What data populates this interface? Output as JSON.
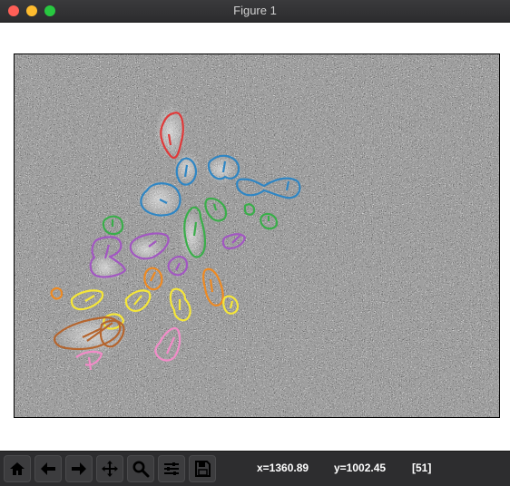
{
  "window": {
    "title": "Figure 1",
    "buttons": [
      "close",
      "minimize",
      "zoom"
    ]
  },
  "toolbar": {
    "tools": [
      {
        "name": "home-icon"
      },
      {
        "name": "back-icon"
      },
      {
        "name": "forward-icon"
      },
      {
        "name": "pan-icon"
      },
      {
        "name": "zoom-icon"
      },
      {
        "name": "configure-subplots-icon"
      },
      {
        "name": "save-icon"
      }
    ],
    "x_readout": "x=1360.89",
    "y_readout": "y=1002.45",
    "frame_readout": "[51]"
  },
  "figure": {
    "background": "noisy grayscale microscopy image",
    "contour_colors": {
      "red": "#e03a3a",
      "blue": "#2f86c4",
      "green": "#3aae4a",
      "purple": "#a257c2",
      "orange": "#ef8a22",
      "yellow": "#f5e638",
      "brown": "#b5652e",
      "pink": "#f28cc8"
    }
  }
}
